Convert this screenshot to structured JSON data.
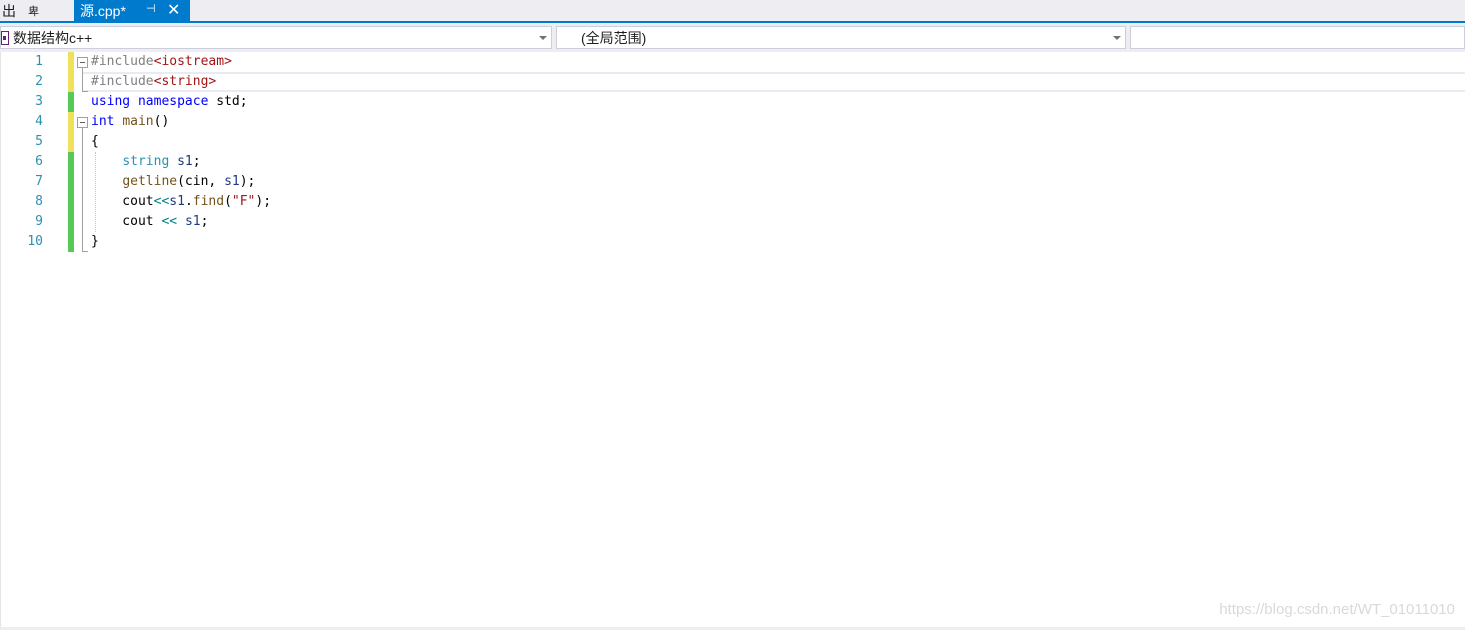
{
  "tabs": {
    "inactive_label": "出",
    "inactive_pin": "卑",
    "active_label": "源.cpp*",
    "active_pin": "⊣",
    "close": "✕"
  },
  "navbar": {
    "project": "数据结构c++",
    "scope": "(全局范围)",
    "member": ""
  },
  "editor": {
    "line_numbers": [
      "1",
      "2",
      "3",
      "4",
      "5",
      "6",
      "7",
      "8",
      "9",
      "10"
    ]
  },
  "watermark": "https://blog.csdn.net/WT_01011010",
  "colors": {
    "accent": "#007acc",
    "line_number": "#2b91af",
    "keyword": "#0000ff",
    "saved_change": "#57c957",
    "unsaved_change": "#f0e05a"
  }
}
